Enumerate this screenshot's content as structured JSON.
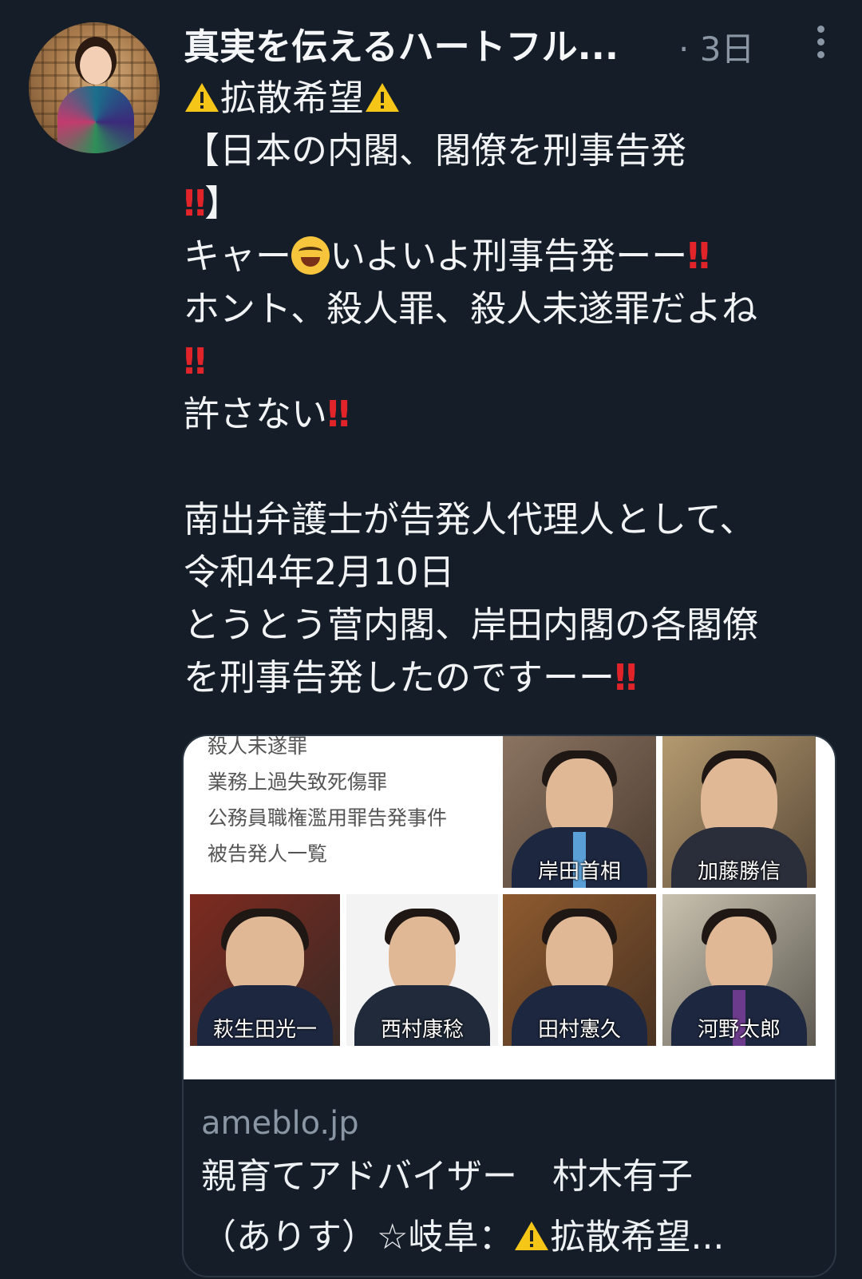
{
  "tweet": {
    "author": "真実を伝えるハートフル...",
    "time": "· 3日",
    "lines": {
      "l1": "拡散希望",
      "l2": "【日本の内閣、閣僚を刑事告発",
      "l3": "】",
      "l4a": "キャー",
      "l4b": "いよいよ刑事告発ーー",
      "l5": "ホント、殺人罪、殺人未遂罪だよね",
      "l7": "許さない",
      "l9": "南出弁護士が告発人代理人として、",
      "l10": "令和4年2月10日",
      "l11": "とうとう菅内閣、岸田内閣の各閣僚",
      "l12": "を刑事告発したのですーー"
    },
    "emoji": {
      "warning": "warning-emoji",
      "double_exclamation": "‼",
      "laugh": "grinning-squinting-face"
    }
  },
  "card": {
    "charges": [
      "殺人未遂罪",
      "業務上過失致死傷罪",
      "公務員職権濫用罪告発事件",
      "被告発人一覧"
    ],
    "photos": [
      "岸田首相",
      "加藤勝信",
      "萩生田光一",
      "西村康稔",
      "田村憲久",
      "河野太郎"
    ],
    "domain": "ameblo.jp",
    "title_line1": "親育てアドバイザー　村木有子",
    "title_line2a": "（ありす）☆岐阜：",
    "title_line2b": "拡散希望..."
  },
  "colors": {
    "background": "#151d28",
    "exclamation": "#e0242a",
    "muted": "#8a96a3"
  }
}
